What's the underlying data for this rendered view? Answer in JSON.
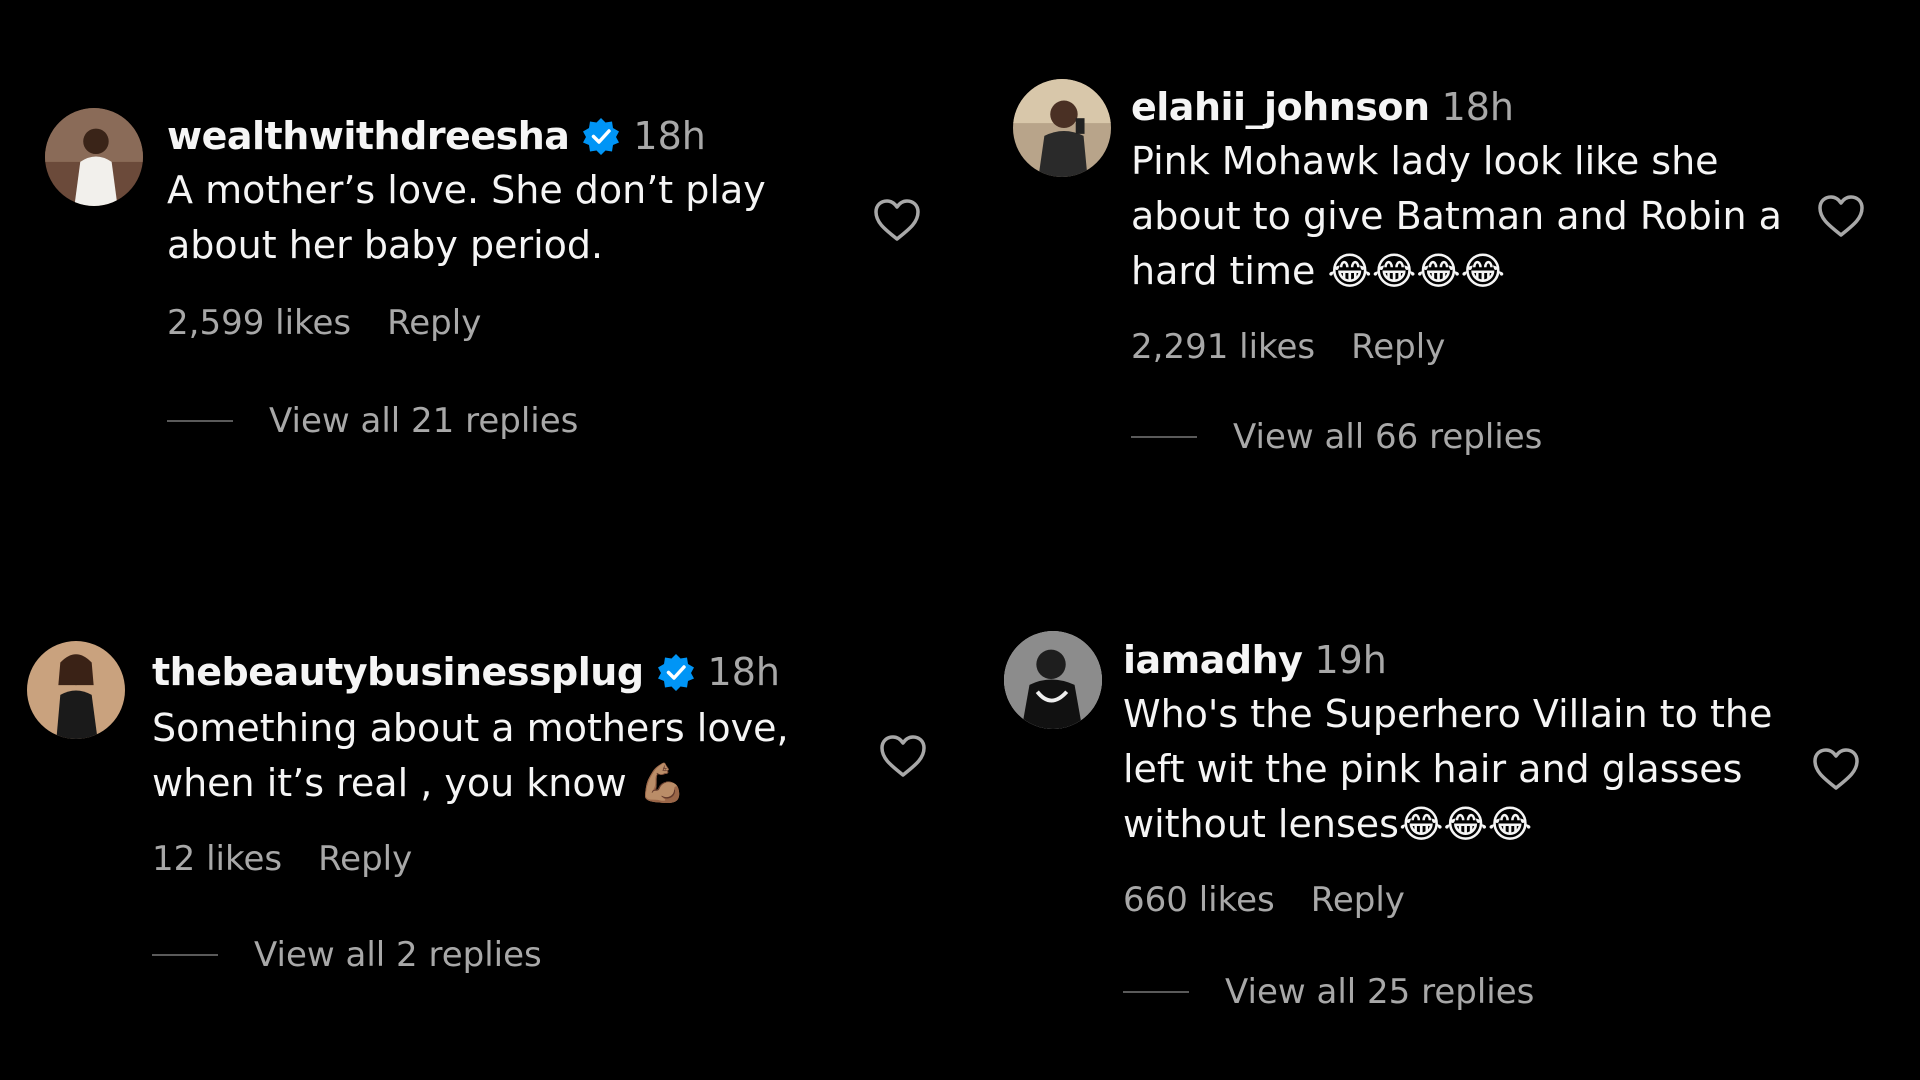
{
  "comments": [
    {
      "username": "wealthwithdreesha",
      "verified": true,
      "time": "18h",
      "text": "A mother’s love. She don’t play\nabout her baby period.",
      "emoji": "",
      "likes": "2,599 likes",
      "reply_label": "Reply",
      "view_replies": "View all 21 replies"
    },
    {
      "username": "elahii_johnson",
      "verified": false,
      "time": "18h",
      "text": "Pink Mohawk lady look like she\nabout to give Batman and Robin a\nhard time ",
      "emoji": "😂😂😂😂",
      "likes": "2,291 likes",
      "reply_label": "Reply",
      "view_replies": "View all 66 replies"
    },
    {
      "username": "thebeautybusinessplug",
      "verified": true,
      "time": "18h",
      "text": "Something about a mothers love,\nwhen it’s real , you know ",
      "emoji": "💪🏽",
      "likes": "12 likes",
      "reply_label": "Reply",
      "view_replies": "View all 2 replies"
    },
    {
      "username": "iamadhy",
      "verified": false,
      "time": "19h",
      "text": "Who's the Superhero Villain to the\nleft wit the pink hair and glasses\nwithout lenses",
      "emoji": "😂😂😂",
      "likes": "660 likes",
      "reply_label": "Reply",
      "view_replies": "View all 25 replies"
    }
  ],
  "colors": {
    "background": "#000000",
    "primary_text": "#f5f5f5",
    "secondary_text": "#a8a8a8",
    "verified_badge": "#0095f6"
  },
  "icons": {
    "like": "heart-outline-icon",
    "verified": "verified-badge-icon"
  }
}
